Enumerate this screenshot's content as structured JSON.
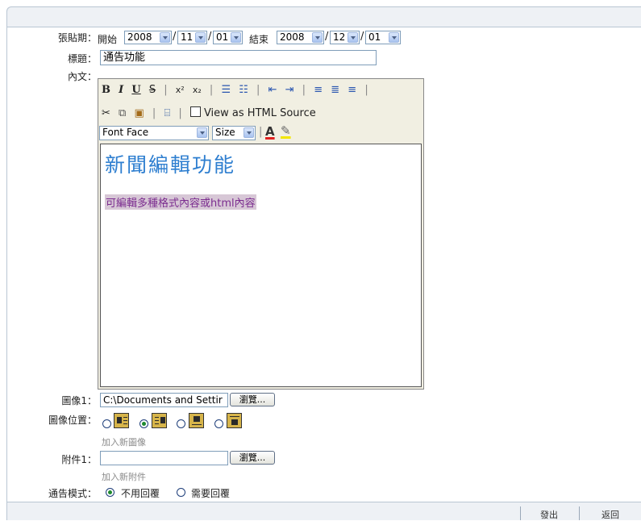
{
  "form": {
    "period_label": "張貼期：",
    "start_label": "開始",
    "end_label": "結束",
    "start": {
      "year": "2008",
      "month": "11",
      "day": "01"
    },
    "end": {
      "year": "2008",
      "month": "12",
      "day": "01"
    },
    "date_sep": "/",
    "title_label": "標題：",
    "title_value": "通告功能",
    "content_label": "內文："
  },
  "editor": {
    "toolbar1": [
      "B",
      "I",
      "U",
      "S",
      "|",
      "x²",
      "x₂",
      "|",
      "☰",
      "☷",
      "|",
      "⇤",
      "⇥",
      "|",
      "≡",
      "≣",
      "≡",
      "|"
    ],
    "toolbar2_icons": [
      "cut-icon",
      "copy-icon",
      "paste-icon",
      "spellcheck-icon"
    ],
    "view_html_label": "View as HTML Source",
    "font_face": "Font Face",
    "size": "Size",
    "heading": "新聞編輯功能",
    "body": "可編輯多種格式內容或html內容"
  },
  "image": {
    "label": "圖像1：",
    "path": "C:\\Documents and Settir",
    "browse": "瀏覽...",
    "position_label": "圖像位置：",
    "add_link": "加入新圖像"
  },
  "attachment": {
    "label": "附件1：",
    "browse": "瀏覽...",
    "add_link": "加入新附件"
  },
  "mode": {
    "label": "通告模式：",
    "options": [
      "不用回覆",
      "需要回覆"
    ]
  },
  "footer": {
    "logout": "發出",
    "back": "返回"
  }
}
